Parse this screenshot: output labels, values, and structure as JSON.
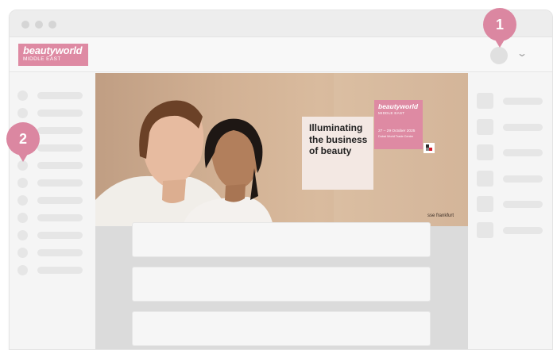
{
  "header": {
    "logo_title": "beautyworld",
    "logo_subtitle": "MIDDLE EAST"
  },
  "hero": {
    "headline_lines": [
      "Illuminating",
      "the business",
      "of beauty"
    ],
    "badge_title": "beautyworld",
    "badge_subtitle": "MIDDLE EAST",
    "badge_dates": "27 – 29 October 2025",
    "badge_venue": "Dubai World Trade Centre",
    "footer_text": "sse frankfurt"
  },
  "callouts": [
    "1",
    "2"
  ],
  "colors": {
    "brand_pink": "#de8aa3",
    "callout_pink": "#db87a1",
    "placeholder_gray": "#e6e6e6"
  },
  "icons": {
    "window_controls": "traffic-light-dots",
    "account": "avatar-circle",
    "dropdown": "chevron-down-icon"
  }
}
